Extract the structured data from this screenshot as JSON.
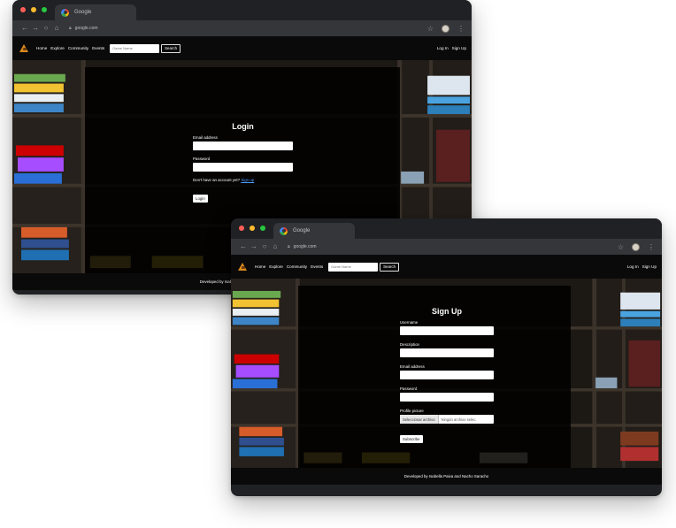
{
  "colors": {
    "window_chrome": "#202124",
    "site_nav": "#0a0a0a",
    "overlay": "#000000",
    "link": "#4d9cff"
  },
  "login_window": {
    "tab_title": "Google",
    "url": "google.com",
    "nav": {
      "links": [
        "Home",
        "Explore",
        "Community",
        "Events"
      ],
      "search_placeholder": "Game Name",
      "search_button": "Search",
      "login": "Log In",
      "signup": "Sign Up"
    },
    "form": {
      "title": "Login",
      "email_label": "Email address",
      "password_label": "Password",
      "hint": "Don't have an account yet?",
      "hint_link": "Sign up",
      "submit": "Login"
    },
    "footer": "Developed by Isabella Paiva and Nacho Saracho"
  },
  "signup_window": {
    "tab_title": "Google",
    "url": "google.com",
    "nav": {
      "links": [
        "Home",
        "Explore",
        "Community",
        "Events"
      ],
      "search_placeholder": "Game Name",
      "search_button": "Search",
      "login": "Log In",
      "signup": "Sign Up"
    },
    "form": {
      "title": "Sign Up",
      "username_label": "Username",
      "description_label": "Description",
      "email_label": "Email address",
      "password_label": "Password",
      "picture_label": "Profile picture",
      "file_choose": "Seleccionar archivo",
      "file_none": "Ningún archivo selec.",
      "submit": "Subscribe"
    },
    "footer": "Developed by Isabella Paiva and Nacho Saracho"
  },
  "icons": {
    "back": "arrow-left-icon",
    "forward": "arrow-right-icon",
    "reload": "reload-icon",
    "home": "home-icon",
    "lock": "lock-icon",
    "star": "star-icon",
    "menu": "kebab-menu-icon"
  }
}
